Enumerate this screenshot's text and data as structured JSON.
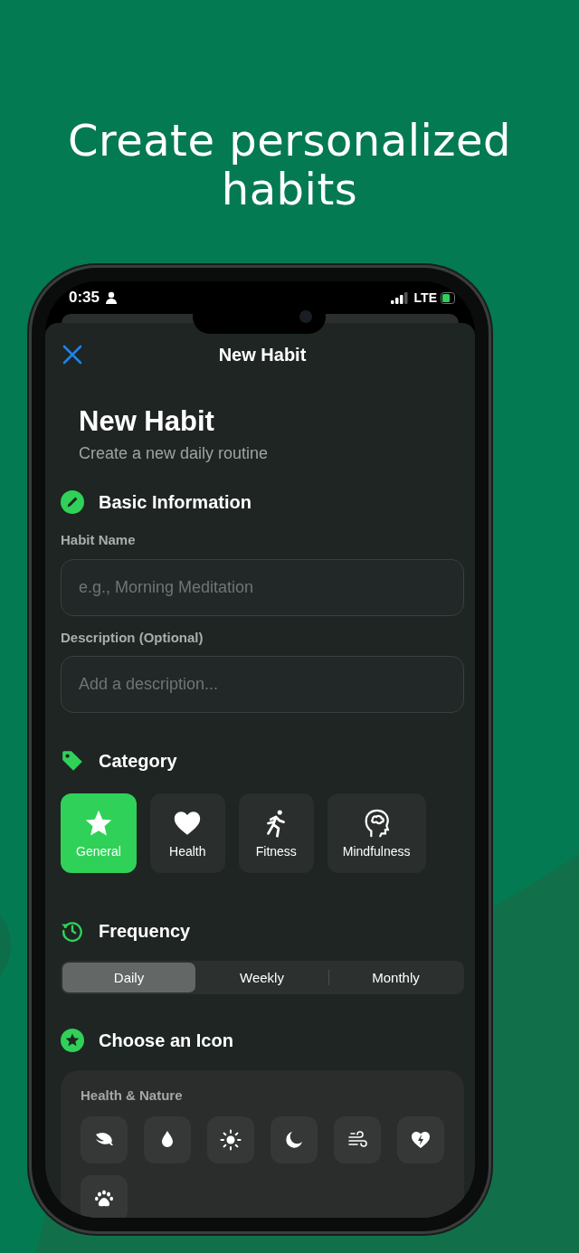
{
  "headline": "Create personalized habits",
  "status_bar": {
    "time": "0:35",
    "network": "LTE"
  },
  "nav": {
    "title": "New Habit"
  },
  "header": {
    "title": "New Habit",
    "subtitle": "Create a new daily routine"
  },
  "basic_info": {
    "title": "Basic Information",
    "fields": [
      {
        "label": "Habit Name",
        "placeholder": "e.g., Morning Meditation"
      },
      {
        "label": "Description (Optional)",
        "placeholder": "Add a description..."
      }
    ]
  },
  "category": {
    "title": "Category",
    "options": [
      {
        "label": "General",
        "selected": true
      },
      {
        "label": "Health",
        "selected": false
      },
      {
        "label": "Fitness",
        "selected": false
      },
      {
        "label": "Mindfulness",
        "selected": false
      }
    ]
  },
  "frequency": {
    "title": "Frequency",
    "options": [
      {
        "label": "Daily",
        "selected": true
      },
      {
        "label": "Weekly",
        "selected": false
      },
      {
        "label": "Monthly",
        "selected": false
      }
    ]
  },
  "icon_picker": {
    "title": "Choose an Icon",
    "group": "Health & Nature"
  }
}
